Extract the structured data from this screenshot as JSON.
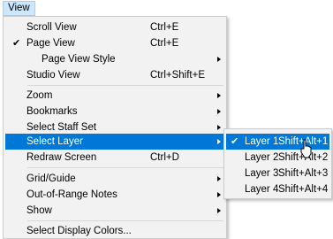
{
  "menubar": {
    "view_label": "View"
  },
  "menu": [
    {
      "label": "Scroll View",
      "shortcut": "Ctrl+E",
      "checked": false,
      "submenu": false
    },
    {
      "label": "Page View",
      "shortcut": "Ctrl+E",
      "checked": true,
      "submenu": false
    },
    {
      "label": "Page View Style",
      "shortcut": "",
      "checked": false,
      "submenu": true
    },
    {
      "label": "Studio View",
      "shortcut": "Ctrl+Shift+E",
      "checked": false,
      "submenu": false
    },
    {
      "label": "Zoom",
      "shortcut": "",
      "checked": false,
      "submenu": true
    },
    {
      "label": "Bookmarks",
      "shortcut": "",
      "checked": false,
      "submenu": true
    },
    {
      "label": "Select Staff Set",
      "shortcut": "",
      "checked": false,
      "submenu": true
    },
    {
      "label": "Select Layer",
      "shortcut": "",
      "checked": false,
      "submenu": true,
      "highlighted": true
    },
    {
      "label": "Redraw Screen",
      "shortcut": "Ctrl+D",
      "checked": false,
      "submenu": false
    },
    {
      "label": "Grid/Guide",
      "shortcut": "",
      "checked": false,
      "submenu": true
    },
    {
      "label": "Out-of-Range Notes",
      "shortcut": "",
      "checked": false,
      "submenu": true
    },
    {
      "label": "Show",
      "shortcut": "",
      "checked": false,
      "submenu": true
    },
    {
      "label": "Select Display Colors...",
      "shortcut": "",
      "checked": false,
      "submenu": false
    }
  ],
  "submenu": [
    {
      "label": "Layer 1",
      "shortcut": "Shift+Alt+1",
      "checked": true,
      "highlighted": true
    },
    {
      "label": "Layer 2",
      "shortcut": "Shift+Alt+2",
      "checked": false
    },
    {
      "label": "Layer 3",
      "shortcut": "Shift+Alt+3",
      "checked": false
    },
    {
      "label": "Layer 4",
      "shortcut": "Shift+Alt+4",
      "checked": false
    }
  ],
  "glyphs": {
    "check": "✔"
  },
  "colors": {
    "highlight": "#0078d7",
    "menu_bg": "#f2f2f2",
    "menubar_active": "#cce8ff"
  }
}
